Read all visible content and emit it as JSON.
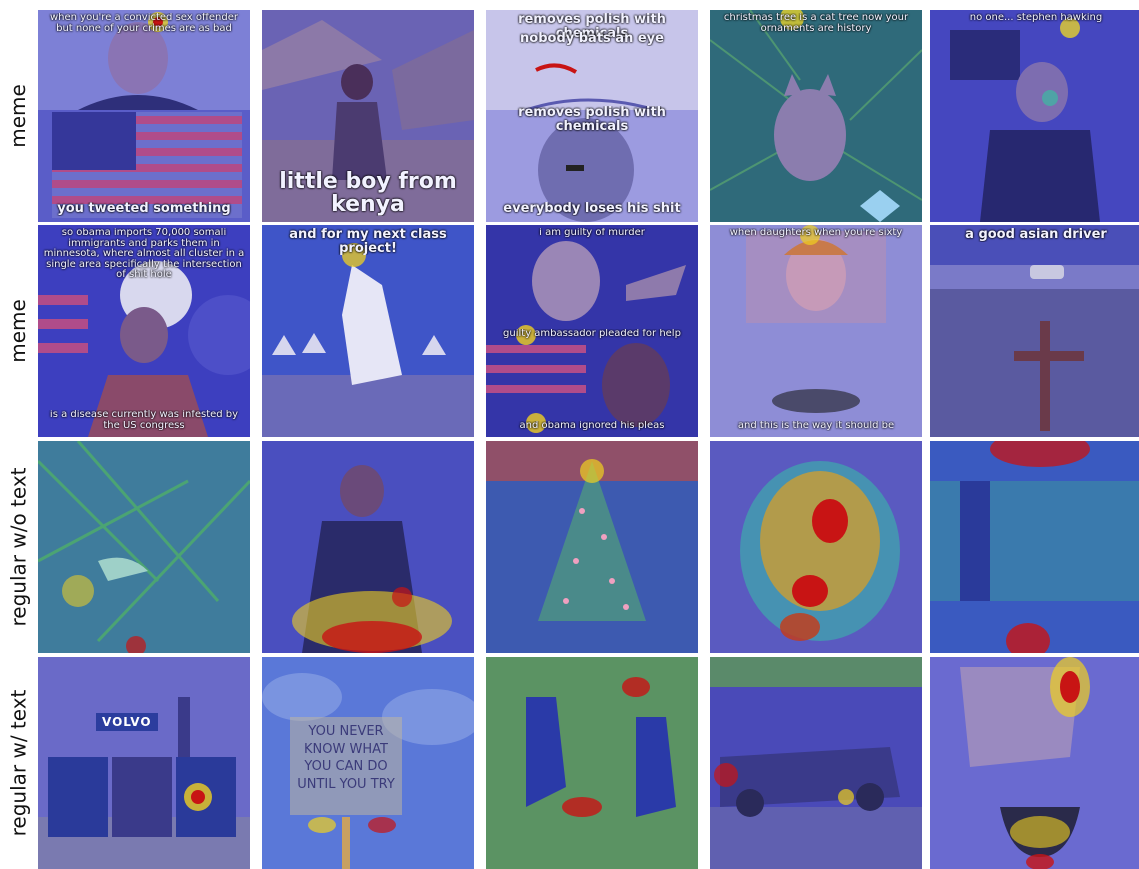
{
  "rows": [
    {
      "label": "meme"
    },
    {
      "label": "meme"
    },
    {
      "label": "regular w/o text"
    },
    {
      "label": "regular w/ text"
    }
  ],
  "tiles": {
    "r0c0": {
      "top": "when you're a convicted sex offender but none of your crimes are as bad",
      "bottom": "you tweeted something"
    },
    "r0c1": {
      "bottom": "little boy from kenya"
    },
    "r0c2": {
      "top_a": "removes polish with chemicals",
      "top_b": "nobody bats an eye",
      "mid": "removes polish with chemicals",
      "bottom": "everybody loses his shit"
    },
    "r0c3": {
      "top": "christmas tree is a cat tree now your ornaments are history"
    },
    "r0c4": {
      "top": "no one... stephen hawking"
    },
    "r1c0": {
      "top": "so obama imports 70,000 somali immigrants and parks them in minnesota, where almost all cluster in a single area specifically the intersection of shit hole",
      "bottom": "is a disease currently was infested by the US congress"
    },
    "r1c1": {
      "top": "and for my next class project!"
    },
    "r1c2": {
      "top": "i am guilty of murder",
      "mid": "guilty ambassador pleaded for help",
      "bottom": "and obama ignored his pleas"
    },
    "r1c3": {
      "top": "when daughters when you're sixty",
      "bottom": "and this is the way it should be"
    },
    "r1c4": {
      "top": "a good asian driver"
    },
    "r3c0": {
      "logo": "VOLVO"
    },
    "r3c1": {
      "sign": "YOU NEVER KNOW WHAT YOU CAN DO UNTIL YOU TRY"
    }
  },
  "colors": {
    "overlay": "#3d3fbf",
    "heat_hot": "#c81414",
    "heat_warm": "#f0d020",
    "heat_cool": "#30c8a0"
  }
}
